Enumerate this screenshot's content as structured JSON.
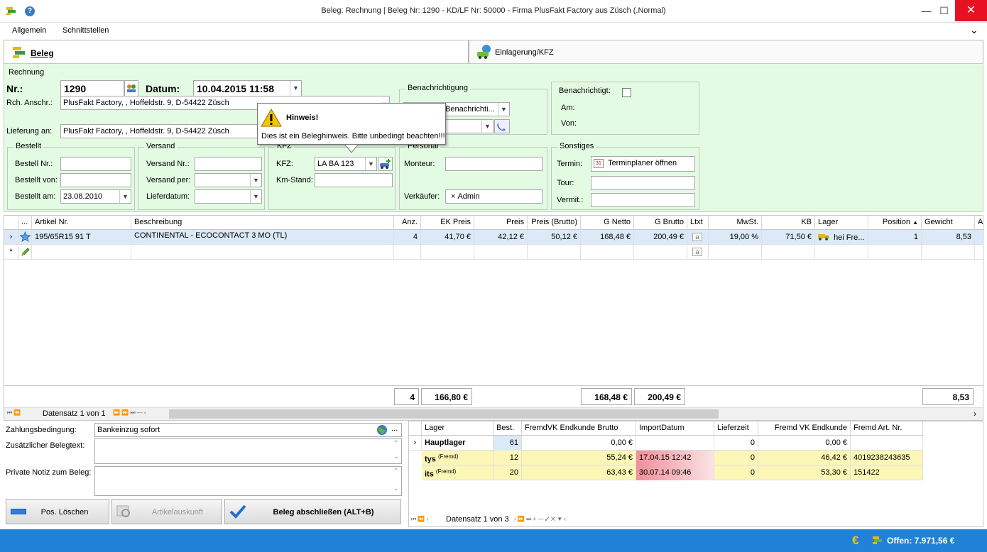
{
  "window": {
    "title": "Beleg: Rechnung | Beleg Nr: 1290 -  KD/LF Nr: 50000 - Firma PlusFakt Factory  aus Züsch (.Normal)",
    "minimize": "—",
    "maximize": "☐",
    "close": "✕"
  },
  "menu": {
    "items": [
      "Allgemein",
      "Schnittstellen"
    ],
    "collapse": "⌄"
  },
  "tabs": [
    {
      "label": "Beleg"
    },
    {
      "label": "Einlagerung/KFZ"
    }
  ],
  "header": {
    "group_title": "Rechnung",
    "nr_label": "Nr.:",
    "nr_value": "1290",
    "datum_label": "Datum:",
    "datum_value": "10.04.2015 11:58",
    "rch_label": "Rch. Anschr.:",
    "rch_value": "PlusFakt Factory,  , Hoffeldstr. 9, D-54422 Züsch",
    "lief_label": "Lieferung an:",
    "lief_value": "PlusFakt Factory,  , Hoffeldstr. 9, D-54422 Züsch",
    "ellipsis": "..."
  },
  "benachrichtigung": {
    "title": "Benachrichtigung",
    "select1": "Benachrichti...",
    "select2": ""
  },
  "benachrichtigt": {
    "label": "Benachrichtigt:",
    "am": "Am:",
    "von": "Von:"
  },
  "bestellt": {
    "title": "Bestellt",
    "nr_label": "Bestell Nr.:",
    "von_label": "Bestellt von:",
    "am_label": "Bestellt am:",
    "am_value": "23.08.2010"
  },
  "versand": {
    "title": "Versand",
    "nr_label": "Versand Nr.:",
    "per_label": "Versand per:",
    "datum_label": "Lieferdatum:"
  },
  "kfz": {
    "title": "KFZ",
    "kfz_label": "KFZ:",
    "kfz_value": "LA BA 123",
    "km_label": "Km-Stand:"
  },
  "personal": {
    "title": "Personal",
    "monteur_label": "Monteur:",
    "verk_label": "Verkäufer:",
    "verk_value": "Admin",
    "remove": "×"
  },
  "sonstiges": {
    "title": "Sonstiges",
    "termin_label": "Termin:",
    "termin_button": "Terminplaner öffnen",
    "tour_label": "Tour:",
    "vermit_label": "Vermit.:"
  },
  "tooltip": {
    "title": "Hinweis!",
    "text": "Dies ist ein Beleghinweis. Bitte unbedingt beachten!!!"
  },
  "grid": {
    "headers": [
      "...",
      "Artikel Nr.",
      "Beschreibung",
      "Anz.",
      "EK Preis",
      "Preis",
      "Preis (Brutto)",
      "G Netto",
      "G Brutto",
      "Ltxt",
      "MwSt.",
      "KB",
      "Lager",
      "Position",
      "Gewicht",
      "A"
    ],
    "row": [
      "195/65R15 91 T",
      "CONTINENTAL - ECOCONTACT 3 MO (TL)",
      "4",
      "41,70 €",
      "42,12 €",
      "50,12 €",
      "168,48 €",
      "200,49 €",
      "",
      "19,00 %",
      "71,50 €",
      "hei Fre...",
      "1",
      "8,53"
    ],
    "row_marker": "›",
    "new_marker": "*",
    "sort_arrow": "▲",
    "ltxt_glyph": "a",
    "totals": {
      "anz": "4",
      "ek": "166,80 €",
      "netto": "168,48 €",
      "brutto": "200,49 €",
      "gewicht": "8,53"
    },
    "nav": "Datensatz 1 von 1",
    "nav_left": "⏮  ⏪",
    "nav_right": "⏩  ⏩  ⏭  —  ‹",
    "scroll_right": "›"
  },
  "bottom": {
    "zahl_label": "Zahlungsbedingung:",
    "zahl_value": "Bankeinzug sofort",
    "zusatz_label": "Zusätzlicher Belegtext:",
    "notiz_label": "Private Notiz zum Beleg:",
    "btn_loeschen": "Pos. Löschen",
    "btn_auskunft": "Artikelauskunft",
    "btn_abschl": "Beleg abschließen (ALT+B)",
    "ellipsis": "...",
    "scroll_up": "⌃",
    "scroll_down": "⌄"
  },
  "stock": {
    "headers": [
      "Lager",
      "Best.",
      "FremdVK Endkunde Brutto",
      "ImportDatum",
      "Lieferzeit",
      "Fremd VK Endkunde",
      "Fremd Art. Nr."
    ],
    "rows": [
      {
        "lager": "Hauptlager",
        "sup": "",
        "best": "61",
        "brutto": "0,00 €",
        "datum": "",
        "lief": "0",
        "vk": "0,00 €",
        "artnr": ""
      },
      {
        "lager": "tys",
        "sup": "(Fremd)",
        "best": "12",
        "brutto": "55,24 €",
        "datum": "17.04.15 12:42",
        "lief": "0",
        "vk": "46,42 €",
        "artnr": "4019238243635"
      },
      {
        "lager": "its",
        "sup": "(Fremd)",
        "best": "20",
        "brutto": "63,43 €",
        "datum": "30.07.14 09:46",
        "lief": "0",
        "vk": "53,30 €",
        "artnr": "151422"
      }
    ],
    "row_marker": "›",
    "nav": "Datensatz 1 von 3",
    "nav_left": "⏮ ⏪ ‹",
    "nav_right": "›  ⏩  ⏭  +  —  ✓  ✕  ▼  ‹"
  },
  "status": {
    "offen": "Offen: 7.971,56 €",
    "euro": "€"
  },
  "colors": {
    "panel_bg": "#e2fbe2",
    "status_bg": "#1f82d7",
    "foreign_row": "#fcf7b6",
    "date_red": "#f08f98",
    "selected_row": "#dbe9f8"
  }
}
